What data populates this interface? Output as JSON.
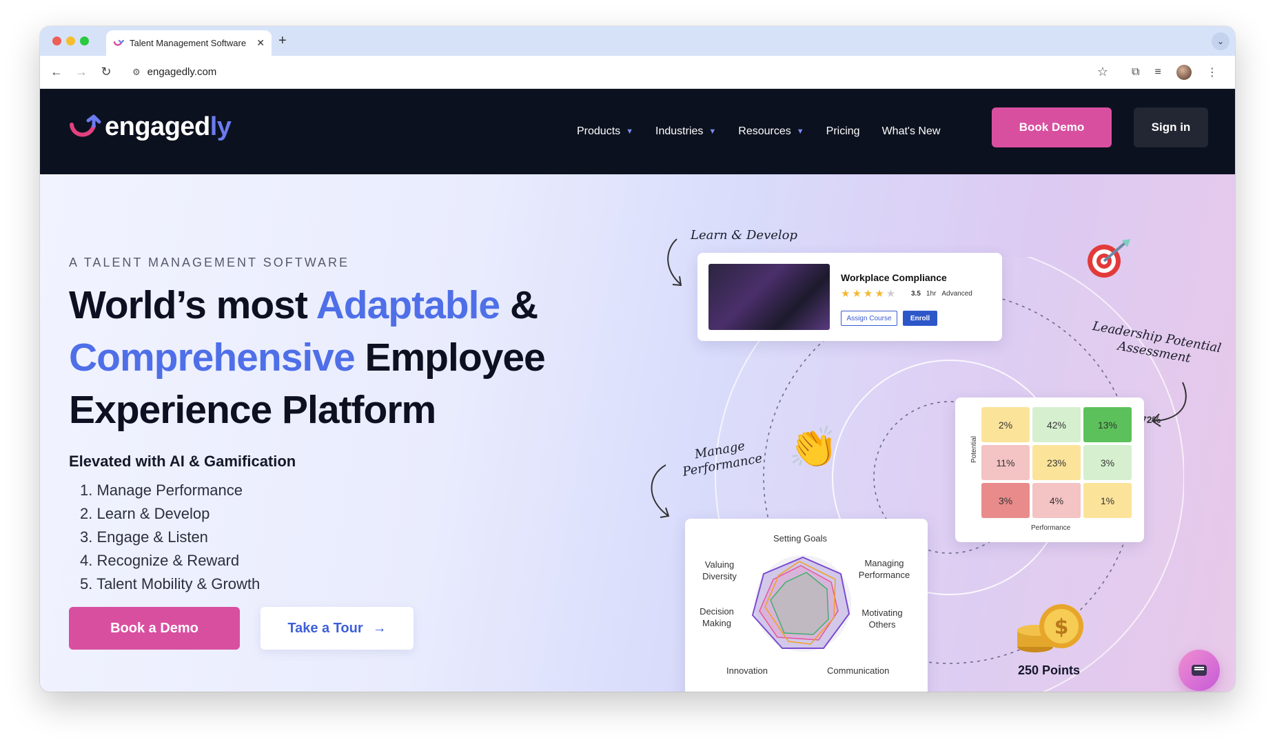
{
  "browser": {
    "tab_title": "Talent Management Software",
    "url": "engagedly.com"
  },
  "nav": {
    "logo_main": "engaged",
    "logo_accent": "ly",
    "items": [
      {
        "label": "Products",
        "dropdown": true
      },
      {
        "label": "Industries",
        "dropdown": true
      },
      {
        "label": "Resources",
        "dropdown": true
      },
      {
        "label": "Pricing",
        "dropdown": false
      },
      {
        "label": "What's New",
        "dropdown": false
      }
    ],
    "book_demo": "Book Demo",
    "sign_in": "Sign in"
  },
  "hero": {
    "eyebrow": "A TALENT MANAGEMENT SOFTWARE",
    "headline": {
      "p1": "World’s most ",
      "accent1": "Adaptable",
      "p2": " & ",
      "accent2": "Comprehensive",
      "p3": " Employee Experience Platform"
    },
    "subheading": "Elevated with AI & Gamification",
    "list": [
      "1. Manage Performance",
      "2. Learn & Develop",
      "3. Engage & Listen",
      "4. Recognize & Reward",
      "5. Talent Mobility & Growth"
    ],
    "cta_primary": "Book a Demo",
    "cta_secondary": "Take a Tour"
  },
  "illustration": {
    "learn_label": "Learn & Develop",
    "leadership_label_1": "Leadership Potential",
    "leadership_label_2": "Assessment",
    "manage_label_1": "Manage",
    "manage_label_2": "Performance",
    "course": {
      "title": "Workplace Compliance",
      "rating": "3.5",
      "duration": "1hr",
      "level": "Advanced",
      "assign": "Assign Course",
      "enroll": "Enroll"
    },
    "goal_progress": {
      "value": 0.72,
      "label": "72%"
    },
    "matrix": {
      "y_label": "Potential",
      "x_label": "Performance",
      "cells": [
        {
          "v": "2%",
          "color": "#fbe39a"
        },
        {
          "v": "42%",
          "color": "#d6efcf"
        },
        {
          "v": "13%",
          "color": "#5cc15a"
        },
        {
          "v": "11%",
          "color": "#f4c3c3"
        },
        {
          "v": "23%",
          "color": "#fbe39a"
        },
        {
          "v": "3%",
          "color": "#d6efcf"
        },
        {
          "v": "3%",
          "color": "#e98b8b"
        },
        {
          "v": "4%",
          "color": "#f4c3c3"
        },
        {
          "v": "1%",
          "color": "#fbe39a"
        }
      ]
    },
    "radar": {
      "labels": [
        "Setting Goals",
        "Managing Performance",
        "Motivating Others",
        "Communication",
        "Innovation",
        "Decision Making",
        "Valuing Diversity"
      ]
    },
    "points": "250 Points"
  }
}
